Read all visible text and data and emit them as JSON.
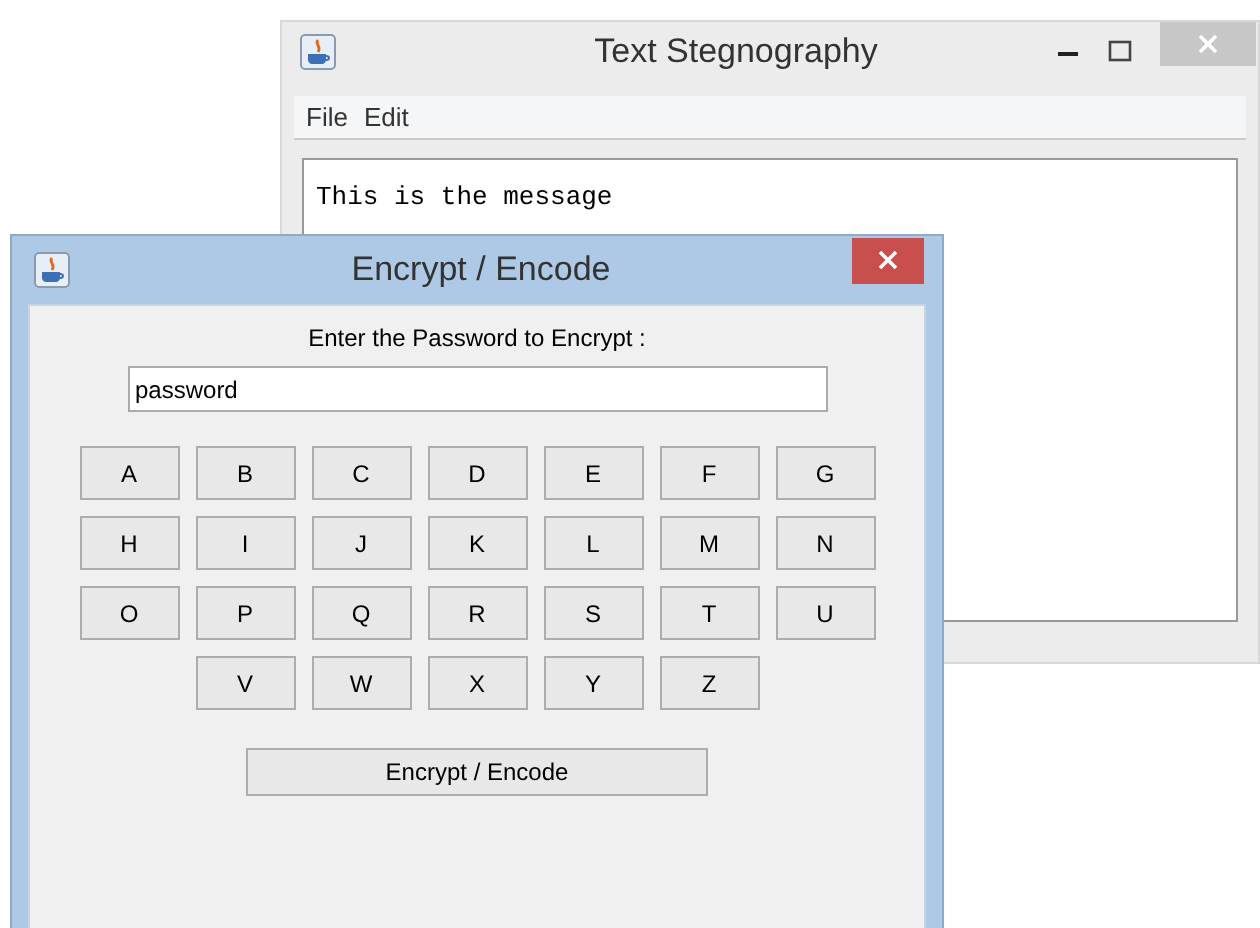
{
  "main_window": {
    "title": "Text Stegnography",
    "menu": [
      "File",
      "Edit"
    ],
    "message": "This is the message"
  },
  "dialog": {
    "title": "Encrypt / Encode",
    "prompt": "Enter the Password to Encrypt :",
    "password": "password",
    "key_rows": [
      [
        "A",
        "B",
        "C",
        "D",
        "E",
        "F",
        "G"
      ],
      [
        "H",
        "I",
        "J",
        "K",
        "L",
        "M",
        "N"
      ],
      [
        "O",
        "P",
        "Q",
        "R",
        "S",
        "T",
        "U"
      ],
      [
        "V",
        "W",
        "X",
        "Y",
        "Z"
      ]
    ],
    "action": "Encrypt / Encode"
  }
}
